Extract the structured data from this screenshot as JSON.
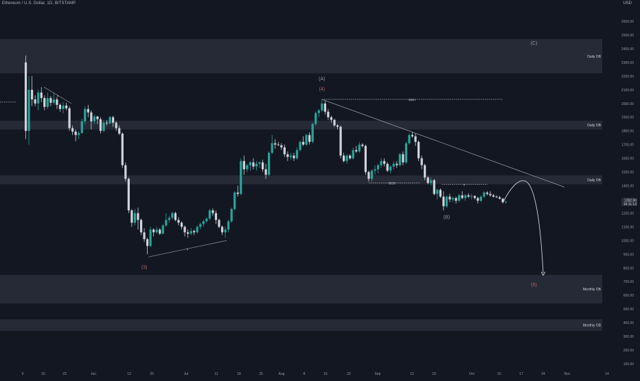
{
  "header": {
    "title": "Ethereum / U.S. Dollar, 1D, BITSTAMP",
    "currency": "USD"
  },
  "theme": {
    "background": "#131722",
    "up_color": "#26a69a",
    "down_color": "#d1d4dc",
    "zone_color": "#2a2e39",
    "annotation_color": "#d1d4dc",
    "wave_count_color": "#b2686a",
    "wave_corrective_color": "#9598a1",
    "axis_text_color": "#9598a1"
  },
  "chart_data": {
    "type": "candlestick",
    "title": "Ethereum / U.S. Dollar, 1D, BITSTAMP",
    "ylabel": "USD",
    "ylim": [
      65,
      2840
    ],
    "grid": false,
    "y_ticks": [
      100,
      200,
      300,
      400,
      500,
      600,
      700,
      800,
      900,
      1000,
      1100,
      1200,
      1300,
      1400,
      1500,
      1600,
      1700,
      1800,
      1900,
      2000,
      2100,
      2200,
      2300,
      2400,
      2500,
      2600
    ],
    "x_ticks": [
      "9",
      "16",
      "23",
      "Jun",
      "13",
      "20",
      "Jul",
      "11",
      "18",
      "25",
      "Aug",
      "8",
      "15",
      "22",
      "Sep",
      "12",
      "19",
      "Oct",
      "10",
      "17",
      "24",
      "Nov",
      "14"
    ],
    "price_labels": [
      "1282.90",
      "16:11:13"
    ],
    "candles": [
      [
        "May 10",
        2300,
        2350,
        1740,
        1800
      ],
      [
        "May 11",
        1800,
        2200,
        1700,
        2100
      ],
      [
        "May 12",
        2100,
        2200,
        1980,
        2030
      ],
      [
        "May 13",
        2030,
        2060,
        1980,
        2000
      ],
      [
        "May 14",
        2000,
        2100,
        1950,
        2080
      ],
      [
        "May 15",
        2080,
        2120,
        2010,
        2040
      ],
      [
        "May 16",
        2040,
        2060,
        1950,
        1975
      ],
      [
        "May 17",
        1975,
        2080,
        1960,
        2040
      ],
      [
        "May 18",
        2040,
        2055,
        1980,
        2005
      ],
      [
        "May 19",
        2005,
        2080,
        1990,
        2030
      ],
      [
        "May 20",
        2030,
        2045,
        1960,
        1990
      ],
      [
        "May 21",
        1990,
        2000,
        1940,
        1960
      ],
      [
        "May 22",
        1960,
        2010,
        1930,
        1985
      ],
      [
        "May 23",
        1985,
        2005,
        1950,
        1965
      ],
      [
        "May 24",
        1965,
        1980,
        1800,
        1820
      ],
      [
        "May 25",
        1820,
        1840,
        1770,
        1795
      ],
      [
        "May 26",
        1795,
        1810,
        1725,
        1770
      ],
      [
        "May 27",
        1770,
        1800,
        1740,
        1785
      ],
      [
        "May 28",
        1785,
        1890,
        1780,
        1870
      ],
      [
        "May 29",
        1870,
        1980,
        1850,
        1960
      ],
      [
        "May 30",
        1960,
        1990,
        1900,
        1935
      ],
      [
        "May 31",
        1935,
        1950,
        1810,
        1870
      ],
      [
        "Jun 1",
        1870,
        1920,
        1850,
        1905
      ],
      [
        "Jun 2",
        1905,
        1910,
        1850,
        1885
      ],
      [
        "Jun 3",
        1885,
        1900,
        1780,
        1800
      ],
      [
        "Jun 4",
        1800,
        1880,
        1790,
        1860
      ],
      [
        "Jun 5",
        1860,
        1880,
        1840,
        1855
      ],
      [
        "Jun 6",
        1855,
        1910,
        1850,
        1900
      ],
      [
        "Jun 7",
        1900,
        1910,
        1830,
        1860
      ],
      [
        "Jun 8",
        1860,
        1870,
        1800,
        1820
      ],
      [
        "Jun 9",
        1820,
        1840,
        1770,
        1780
      ],
      [
        "Jun 10",
        1780,
        1790,
        1530,
        1550
      ],
      [
        "Jun 11",
        1550,
        1570,
        1430,
        1450
      ],
      [
        "Jun 12",
        1450,
        1460,
        1200,
        1220
      ],
      [
        "Jun 13",
        1220,
        1230,
        1100,
        1130
      ],
      [
        "Jun 14",
        1130,
        1230,
        1110,
        1200
      ],
      [
        "Jun 15",
        1200,
        1240,
        1080,
        1150
      ],
      [
        "Jun 16",
        1150,
        1160,
        1040,
        1060
      ],
      [
        "Jun 17",
        1060,
        1090,
        990,
        1010
      ],
      [
        "Jun 18",
        1010,
        1020,
        900,
        960
      ],
      [
        "Jun 19",
        960,
        1100,
        950,
        1080
      ],
      [
        "Jun 20",
        1080,
        1090,
        1030,
        1060
      ],
      [
        "Jun 21",
        1060,
        1100,
        1050,
        1080
      ],
      [
        "Jun 22",
        1080,
        1090,
        1040,
        1050
      ],
      [
        "Jun 23",
        1050,
        1120,
        1045,
        1110
      ],
      [
        "Jun 24",
        1110,
        1200,
        1100,
        1150
      ],
      [
        "Jun 25",
        1150,
        1180,
        1130,
        1165
      ],
      [
        "Jun 26",
        1165,
        1210,
        1150,
        1200
      ],
      [
        "Jun 27",
        1200,
        1210,
        1140,
        1150
      ],
      [
        "Jun 28",
        1150,
        1170,
        1110,
        1130
      ],
      [
        "Jun 29",
        1130,
        1140,
        1080,
        1100
      ],
      [
        "Jun 30",
        1100,
        1110,
        1030,
        1060
      ],
      [
        "Jul 1",
        1060,
        1080,
        1020,
        1050
      ],
      [
        "Jul 2",
        1050,
        1090,
        1040,
        1070
      ],
      [
        "Jul 3",
        1070,
        1080,
        1040,
        1060
      ],
      [
        "Jul 4",
        1060,
        1110,
        1050,
        1100
      ],
      [
        "Jul 5",
        1100,
        1130,
        1080,
        1120
      ],
      [
        "Jul 6",
        1120,
        1150,
        1100,
        1140
      ],
      [
        "Jul 7",
        1140,
        1170,
        1130,
        1160
      ],
      [
        "Jul 8",
        1160,
        1230,
        1150,
        1220
      ],
      [
        "Jul 9",
        1220,
        1235,
        1180,
        1200
      ],
      [
        "Jul 10",
        1200,
        1220,
        1120,
        1150
      ],
      [
        "Jul 11",
        1150,
        1160,
        1090,
        1100
      ],
      [
        "Jul 12",
        1100,
        1110,
        1040,
        1060
      ],
      [
        "Jul 13",
        1060,
        1100,
        1020,
        1080
      ],
      [
        "Jul 14",
        1080,
        1150,
        1060,
        1140
      ],
      [
        "Jul 15",
        1140,
        1240,
        1130,
        1230
      ],
      [
        "Jul 16",
        1230,
        1360,
        1220,
        1350
      ],
      [
        "Jul 17",
        1350,
        1400,
        1320,
        1340
      ],
      [
        "Jul 18",
        1340,
        1600,
        1330,
        1580
      ],
      [
        "Jul 19",
        1580,
        1620,
        1480,
        1520
      ],
      [
        "Jul 20",
        1520,
        1560,
        1500,
        1550
      ],
      [
        "Jul 21",
        1550,
        1580,
        1510,
        1570
      ],
      [
        "Jul 22",
        1570,
        1600,
        1520,
        1540
      ],
      [
        "Jul 23",
        1540,
        1580,
        1510,
        1560
      ],
      [
        "Jul 24",
        1560,
        1580,
        1530,
        1570
      ],
      [
        "Jul 25",
        1570,
        1590,
        1500,
        1520
      ],
      [
        "Jul 26",
        1520,
        1560,
        1450,
        1480
      ],
      [
        "Jul 27",
        1480,
        1650,
        1470,
        1640
      ],
      [
        "Jul 28",
        1640,
        1770,
        1630,
        1710
      ],
      [
        "Jul 29",
        1710,
        1740,
        1670,
        1700
      ],
      [
        "Jul 30",
        1700,
        1720,
        1690,
        1695
      ],
      [
        "Jul 31",
        1695,
        1710,
        1660,
        1680
      ],
      [
        "Aug 1",
        1680,
        1700,
        1610,
        1630
      ],
      [
        "Aug 2",
        1630,
        1650,
        1580,
        1610
      ],
      [
        "Aug 3",
        1610,
        1640,
        1590,
        1620
      ],
      [
        "Aug 4",
        1620,
        1640,
        1580,
        1600
      ],
      [
        "Aug 5",
        1600,
        1680,
        1590,
        1660
      ],
      [
        "Aug 6",
        1660,
        1730,
        1650,
        1720
      ],
      [
        "Aug 7",
        1720,
        1760,
        1690,
        1700
      ],
      [
        "Aug 8",
        1700,
        1780,
        1690,
        1770
      ],
      [
        "Aug 9",
        1770,
        1790,
        1700,
        1720
      ],
      [
        "Aug 10",
        1720,
        1860,
        1710,
        1850
      ],
      [
        "Aug 11",
        1850,
        1940,
        1840,
        1930
      ],
      [
        "Aug 12",
        1930,
        1960,
        1900,
        1950
      ],
      [
        "Aug 13",
        1950,
        2030,
        1940,
        2000
      ],
      [
        "Aug 14",
        2000,
        2020,
        1920,
        1940
      ],
      [
        "Aug 15",
        1940,
        1960,
        1880,
        1900
      ],
      [
        "Aug 16",
        1900,
        1910,
        1860,
        1880
      ],
      [
        "Aug 17",
        1880,
        1890,
        1830,
        1840
      ],
      [
        "Aug 18",
        1840,
        1850,
        1810,
        1830
      ],
      [
        "Aug 19",
        1830,
        1840,
        1600,
        1620
      ],
      [
        "Aug 20",
        1620,
        1640,
        1570,
        1580
      ],
      [
        "Aug 21",
        1580,
        1630,
        1560,
        1620
      ],
      [
        "Aug 22",
        1620,
        1630,
        1590,
        1600
      ],
      [
        "Aug 23",
        1600,
        1680,
        1590,
        1660
      ],
      [
        "Aug 24",
        1660,
        1690,
        1640,
        1650
      ],
      [
        "Aug 25",
        1650,
        1720,
        1640,
        1700
      ],
      [
        "Aug 26",
        1700,
        1710,
        1680,
        1690
      ],
      [
        "Aug 27",
        1690,
        1700,
        1480,
        1500
      ],
      [
        "Aug 28",
        1500,
        1510,
        1430,
        1450
      ],
      [
        "Aug 29",
        1450,
        1520,
        1430,
        1510
      ],
      [
        "Aug 30",
        1510,
        1550,
        1480,
        1520
      ],
      [
        "Aug 31",
        1520,
        1560,
        1490,
        1550
      ],
      [
        "Sep 1",
        1550,
        1600,
        1530,
        1580
      ],
      [
        "Sep 2",
        1580,
        1600,
        1540,
        1560
      ],
      [
        "Sep 3",
        1560,
        1570,
        1500,
        1510
      ],
      [
        "Sep 4",
        1510,
        1550,
        1490,
        1540
      ],
      [
        "Sep 5",
        1540,
        1580,
        1520,
        1560
      ],
      [
        "Sep 6",
        1560,
        1580,
        1530,
        1550
      ],
      [
        "Sep 7",
        1550,
        1640,
        1540,
        1630
      ],
      [
        "Sep 8",
        1630,
        1650,
        1550,
        1570
      ],
      [
        "Sep 9",
        1570,
        1720,
        1560,
        1710
      ],
      [
        "Sep 10",
        1710,
        1780,
        1700,
        1770
      ],
      [
        "Sep 11",
        1770,
        1790,
        1750,
        1760
      ],
      [
        "Sep 12",
        1760,
        1780,
        1690,
        1720
      ],
      [
        "Sep 13",
        1720,
        1730,
        1580,
        1600
      ],
      [
        "Sep 14",
        1600,
        1620,
        1520,
        1550
      ],
      [
        "Sep 15",
        1550,
        1560,
        1440,
        1460
      ],
      [
        "Sep 16",
        1460,
        1470,
        1410,
        1420
      ],
      [
        "Sep 17",
        1420,
        1460,
        1400,
        1440
      ],
      [
        "Sep 18",
        1440,
        1450,
        1330,
        1340
      ],
      [
        "Sep 19",
        1340,
        1380,
        1300,
        1370
      ],
      [
        "Sep 20",
        1370,
        1380,
        1310,
        1320
      ],
      [
        "Sep 21",
        1320,
        1360,
        1220,
        1250
      ],
      [
        "Sep 22",
        1250,
        1330,
        1240,
        1320
      ],
      [
        "Sep 23",
        1320,
        1340,
        1280,
        1300
      ],
      [
        "Sep 24",
        1300,
        1320,
        1280,
        1310
      ],
      [
        "Sep 25",
        1310,
        1320,
        1270,
        1290
      ],
      [
        "Sep 26",
        1290,
        1340,
        1280,
        1330
      ],
      [
        "Sep 27",
        1330,
        1360,
        1300,
        1310
      ],
      [
        "Sep 28",
        1310,
        1340,
        1290,
        1330
      ],
      [
        "Sep 29",
        1330,
        1345,
        1310,
        1320
      ],
      [
        "Sep 30",
        1320,
        1340,
        1300,
        1325
      ],
      [
        "Oct 1",
        1325,
        1330,
        1300,
        1310
      ],
      [
        "Oct 2",
        1310,
        1320,
        1270,
        1290
      ],
      [
        "Oct 3",
        1290,
        1330,
        1280,
        1320
      ],
      [
        "Oct 4",
        1320,
        1360,
        1310,
        1350
      ],
      [
        "Oct 5",
        1350,
        1360,
        1330,
        1340
      ],
      [
        "Oct 6",
        1340,
        1360,
        1320,
        1330
      ],
      [
        "Oct 7",
        1330,
        1340,
        1315,
        1320
      ],
      [
        "Oct 8",
        1320,
        1330,
        1310,
        1315
      ],
      [
        "Oct 9",
        1315,
        1325,
        1300,
        1305
      ],
      [
        "Oct 10",
        1305,
        1310,
        1270,
        1280
      ],
      [
        "Oct 11",
        1280,
        1290,
        1270,
        1283
      ]
    ],
    "zones": [
      {
        "label": "Daily OB",
        "low": 2220,
        "high": 2470
      },
      {
        "label": "Daily OB",
        "low": 1810,
        "high": 1875
      },
      {
        "label": "Daily OB",
        "low": 1410,
        "high": 1475
      },
      {
        "label": "Monthly OB",
        "low": 540,
        "high": 750
      },
      {
        "label": "Monthly OB",
        "low": 340,
        "high": 425
      }
    ],
    "annotations": {
      "wave_labels": [
        {
          "text": "(A)",
          "date": "Aug 13",
          "price": 2170,
          "kind": "corrective"
        },
        {
          "text": "(4)",
          "date": "Aug 13",
          "price": 2095,
          "kind": "impulse"
        },
        {
          "text": "(C)",
          "date": "Oct 20",
          "price": 2430,
          "kind": "corrective"
        },
        {
          "text": "(B)",
          "date": "Sep 22",
          "price": 1160,
          "kind": "corrective"
        },
        {
          "text": "(3)",
          "date": "Jun 17",
          "price": 795,
          "kind": "impulse"
        },
        {
          "text": "(5)",
          "date": "Oct 20",
          "price": 665,
          "kind": "impulse"
        }
      ],
      "line_labels": [
        "DSH",
        "BOS",
        "x",
        "x",
        "x"
      ]
    }
  }
}
